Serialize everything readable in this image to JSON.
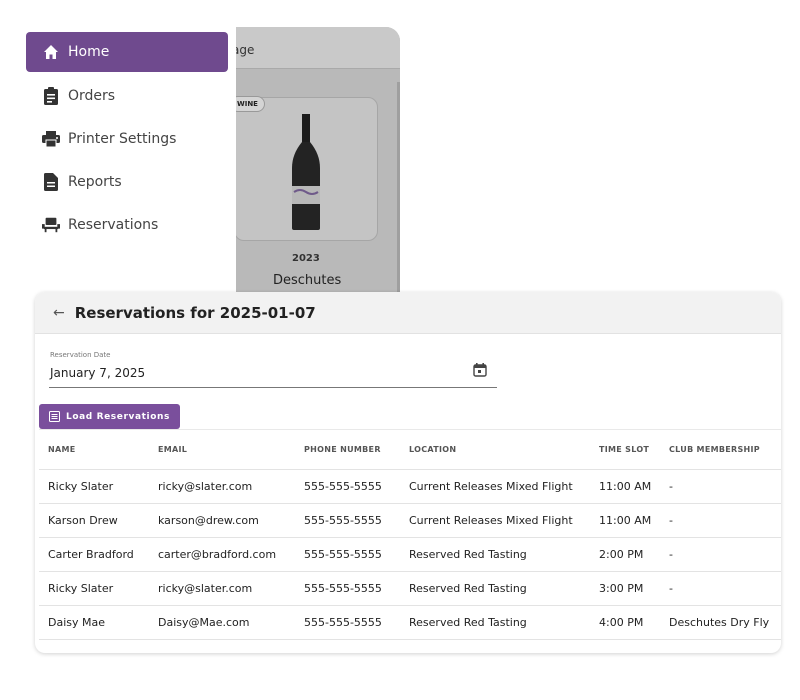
{
  "background": {
    "header_partial": "age",
    "badge": "WINE",
    "year": "2023",
    "product_name": "Deschutes"
  },
  "nav": {
    "items": [
      {
        "label": "Home",
        "icon": "home-icon",
        "active": true
      },
      {
        "label": "Orders",
        "icon": "clipboard-icon",
        "active": false
      },
      {
        "label": "Printer Settings",
        "icon": "printer-icon",
        "active": false
      },
      {
        "label": "Reports",
        "icon": "document-icon",
        "active": false
      },
      {
        "label": "Reservations",
        "icon": "seat-icon",
        "active": false
      }
    ]
  },
  "panel": {
    "title": "Reservations for 2025-01-07",
    "date_label": "Reservation Date",
    "date_value": "January 7, 2025",
    "load_button": "Load Reservations"
  },
  "table": {
    "headers": [
      "NAME",
      "EMAIL",
      "PHONE NUMBER",
      "LOCATION",
      "TIME SLOT",
      "CLUB MEMBERSHIP"
    ],
    "rows": [
      [
        "Ricky Slater",
        "ricky@slater.com",
        "555-555-5555",
        "Current Releases Mixed Flight",
        "11:00 AM",
        "-"
      ],
      [
        "Karson Drew",
        "karson@drew.com",
        "555-555-5555",
        "Current Releases Mixed Flight",
        "11:00 AM",
        "-"
      ],
      [
        "Carter Bradford",
        "carter@bradford.com",
        "555-555-5555",
        "Reserved Red Tasting",
        "2:00 PM",
        "-"
      ],
      [
        "Ricky Slater",
        "ricky@slater.com",
        "555-555-5555",
        "Reserved Red Tasting",
        "3:00 PM",
        "-"
      ],
      [
        "Daisy Mae",
        "Daisy@Mae.com",
        "555-555-5555",
        "Reserved Red Tasting",
        "4:00 PM",
        "Deschutes Dry Fly"
      ]
    ]
  },
  "colors": {
    "accent": "#6f4a8e",
    "button": "#7a4f9c"
  }
}
